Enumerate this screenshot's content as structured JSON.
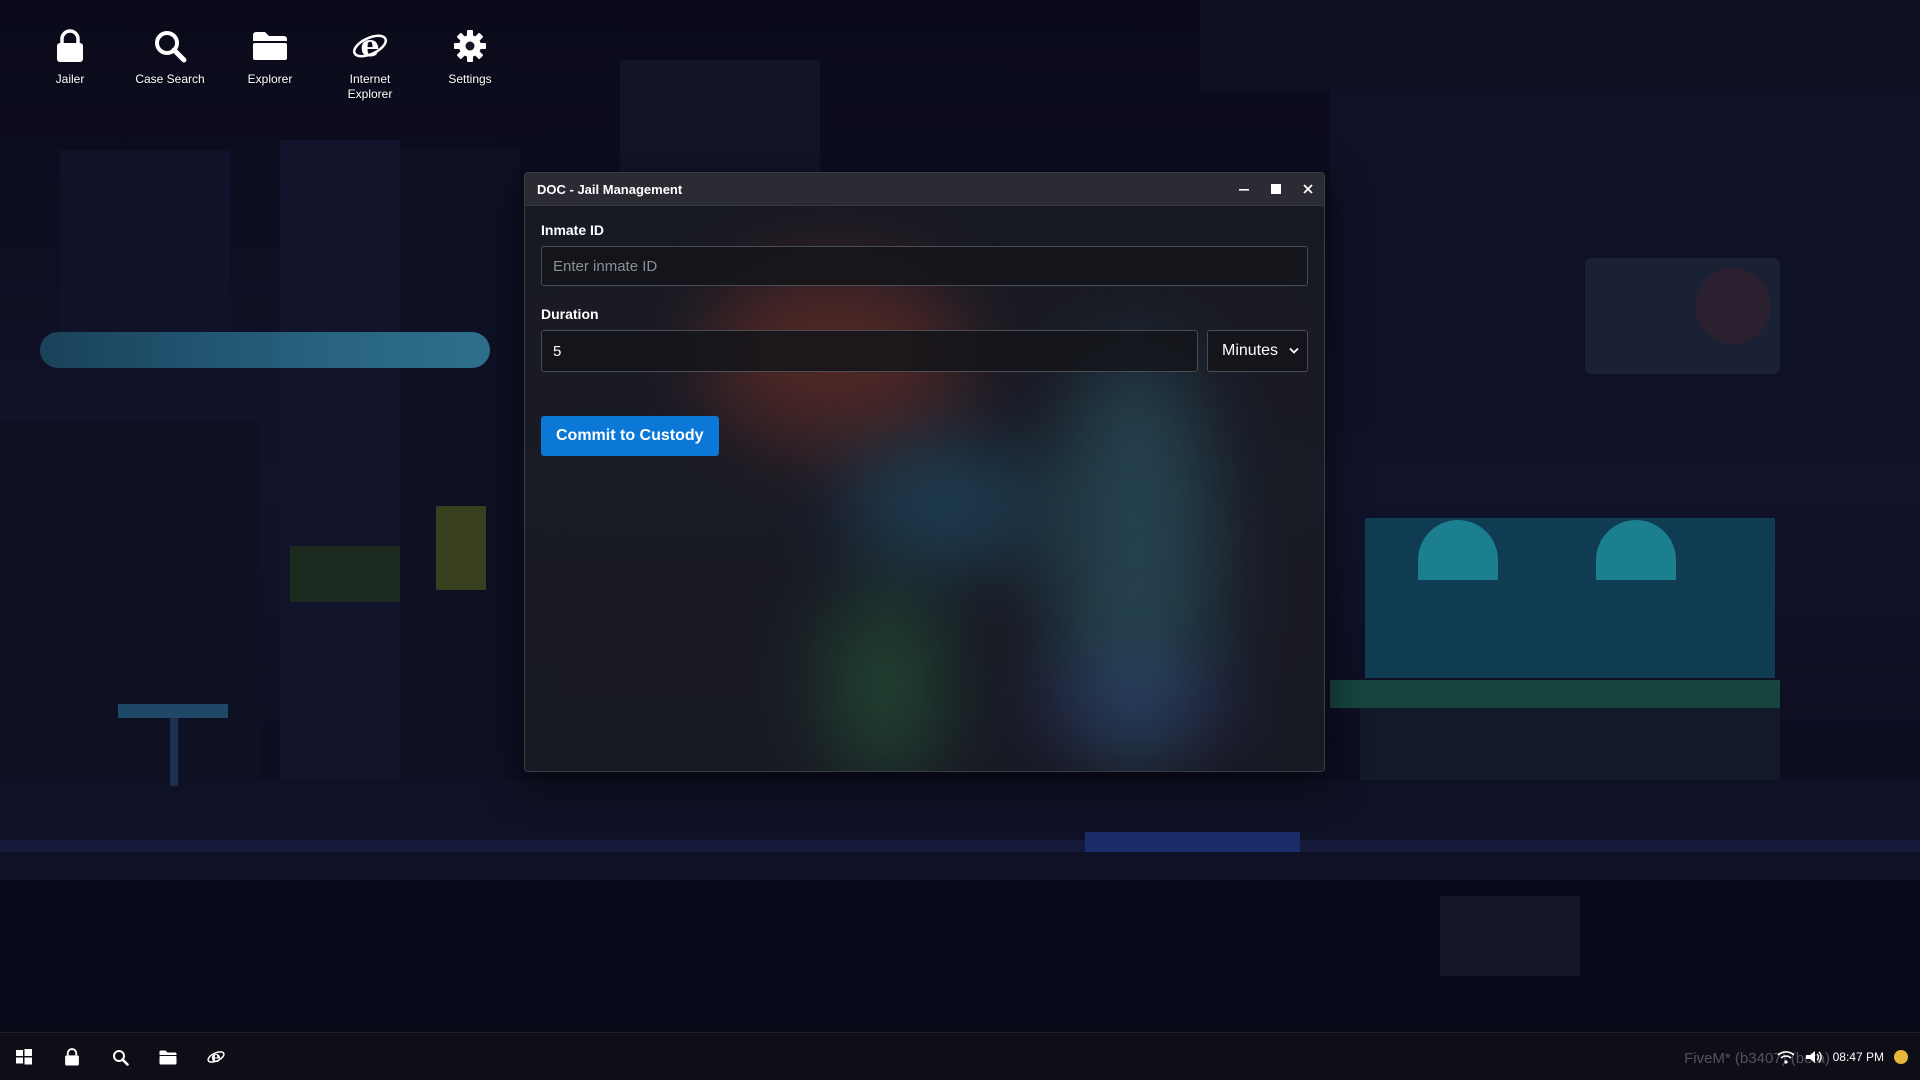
{
  "desktop": {
    "icons": [
      {
        "label": "Jailer",
        "icon": "lock-icon"
      },
      {
        "label": "Case Search",
        "icon": "search-icon"
      },
      {
        "label": "Explorer",
        "icon": "folder-icon"
      },
      {
        "label": "Internet Explorer",
        "icon": "internet-explorer-icon"
      },
      {
        "label": "Settings",
        "icon": "gear-icon"
      }
    ]
  },
  "window": {
    "title": "DOC - Jail Management",
    "inmate_id": {
      "label": "Inmate ID",
      "placeholder": "Enter inmate ID",
      "value": ""
    },
    "duration": {
      "label": "Duration",
      "value": "5",
      "unit": "Minutes"
    },
    "commit_label": "Commit to Custody"
  },
  "taskbar": {
    "items": [
      "windows-start-icon",
      "lock-icon",
      "search-icon",
      "folder-icon",
      "internet-explorer-icon"
    ],
    "watermark": "FiveM* (b3407) (beta)",
    "clock": "08:47 PM"
  },
  "colors": {
    "accent": "#0b78d8",
    "window_bg": "#1c1d24",
    "titlebar_bg": "#2b2c33",
    "notify": "#e7b63a"
  }
}
